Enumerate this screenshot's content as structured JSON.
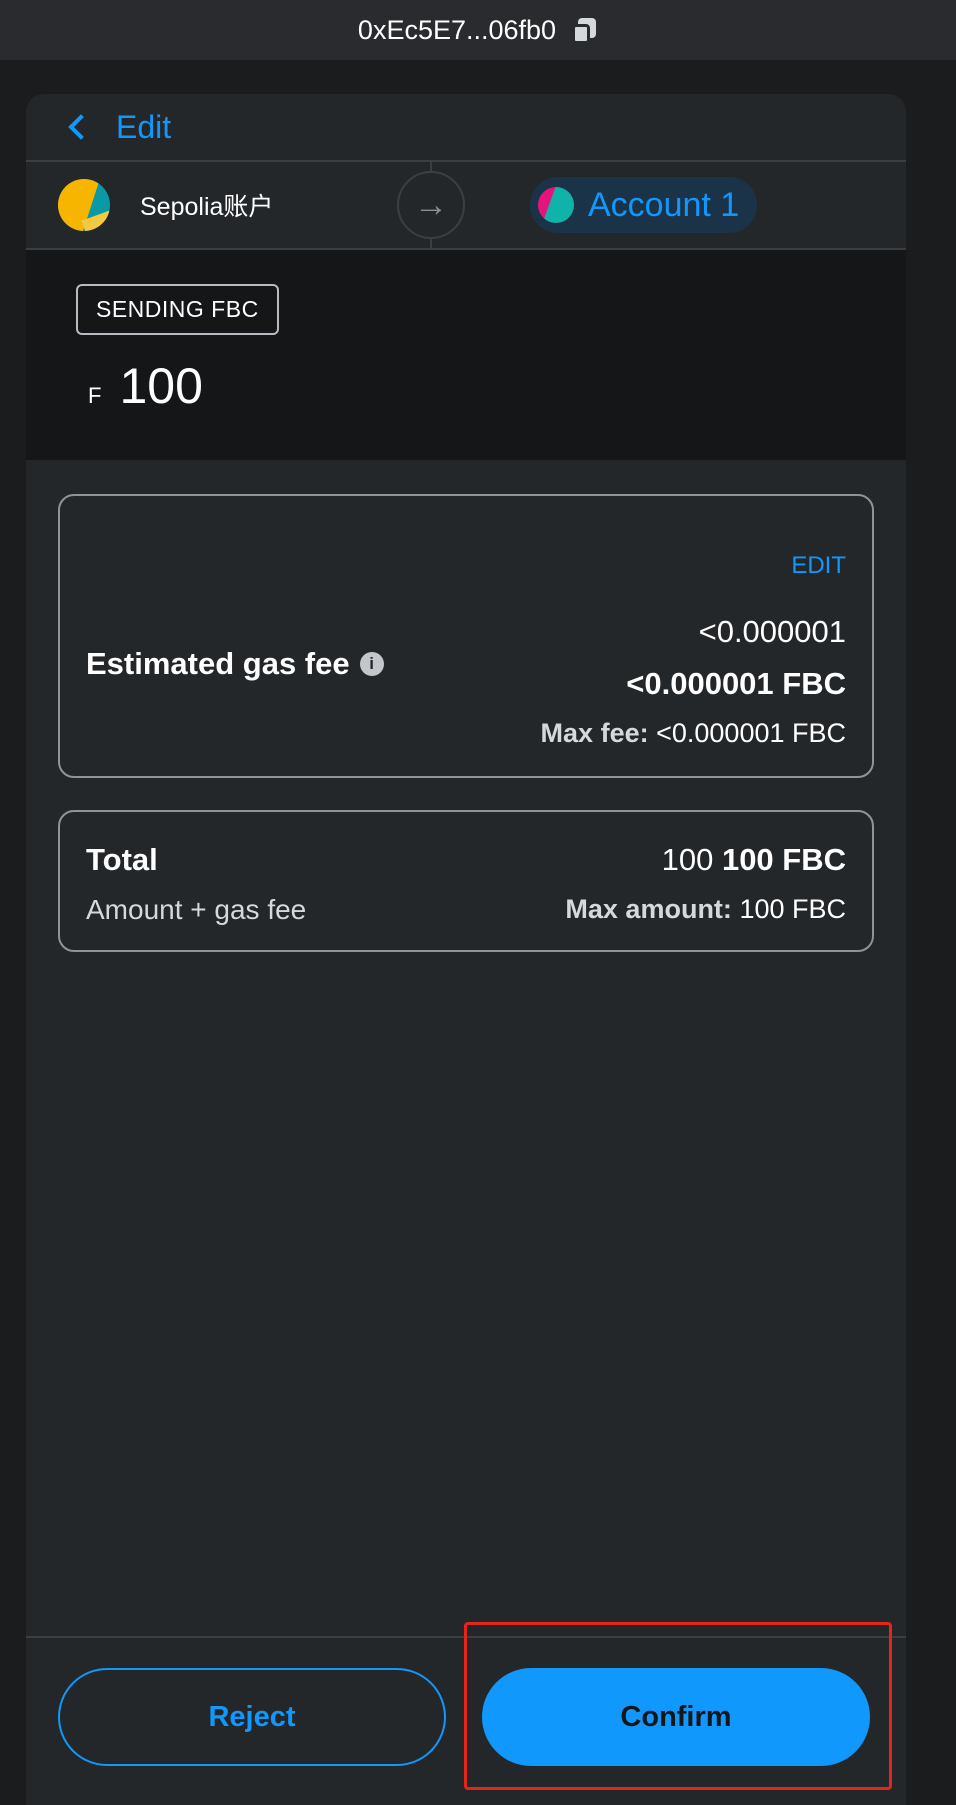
{
  "header": {
    "address": "0xEc5E7...06fb0",
    "copy_icon": "copy-icon"
  },
  "nav": {
    "back_label": "Edit"
  },
  "accounts": {
    "from_name": "Sepolia账户",
    "to_name": "Account 1",
    "arrow_icon": "arrow-right-icon"
  },
  "sending": {
    "badge": "SENDING FBC",
    "currency_symbol": "F",
    "amount": "100"
  },
  "gas": {
    "edit_label": "EDIT",
    "label": "Estimated gas fee",
    "info_icon": "info-icon",
    "fiat_value": "<0.000001",
    "token_value": "<0.000001 FBC",
    "max_fee_label": "Max fee:",
    "max_fee_value": "<0.000001 FBC"
  },
  "total": {
    "label": "Total",
    "sublabel": "Amount + gas fee",
    "value_plain": "100",
    "value_bold": "100 FBC",
    "max_amount_label": "Max amount:",
    "max_amount_value": "100 FBC"
  },
  "footer": {
    "reject_label": "Reject",
    "confirm_label": "Confirm"
  },
  "colors": {
    "accent": "#1098fc",
    "highlight": "#e3251c",
    "panel": "#24272a"
  }
}
